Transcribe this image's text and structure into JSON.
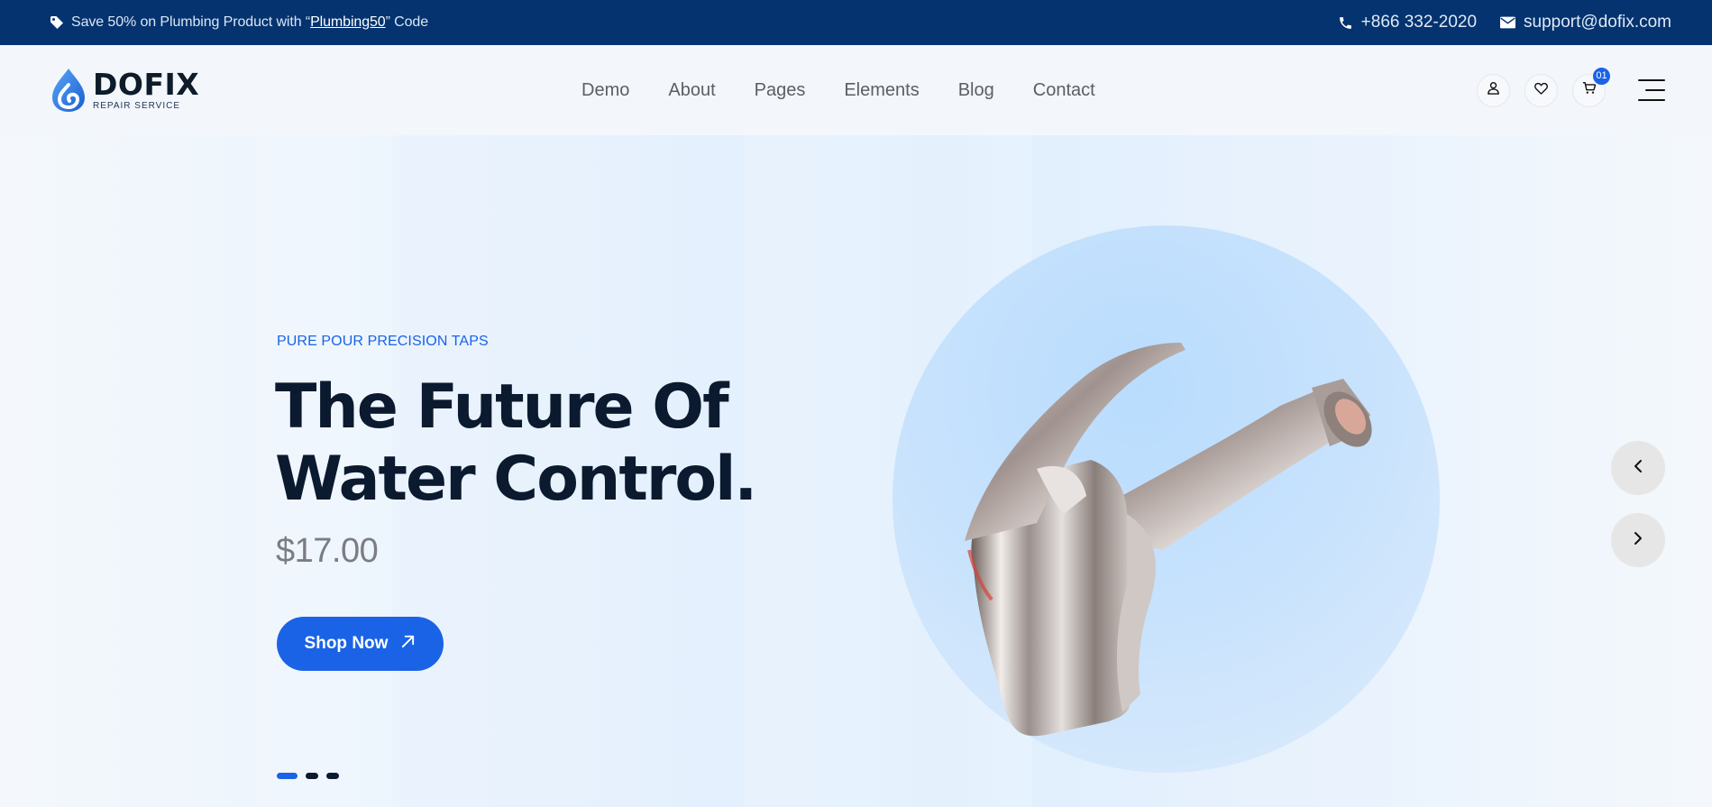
{
  "topbar": {
    "promo_prefix": "Save 50% on Plumbing Product with “",
    "promo_code": "Plumbing50",
    "promo_suffix": "” Code",
    "phone": "+866 332-2020",
    "email": "support@dofix.com",
    "icons": [
      "tag-icon",
      "phone-icon",
      "envelope-icon"
    ]
  },
  "brand": {
    "name": "DOFIX",
    "tagline": "REPAIR SERVICE"
  },
  "nav": {
    "items": [
      "Demo",
      "About",
      "Pages",
      "Elements",
      "Blog",
      "Contact"
    ]
  },
  "header_actions": {
    "cart_count": "01",
    "icons": [
      "user-icon",
      "heart-icon",
      "cart-icon",
      "hamburger-menu-icon"
    ]
  },
  "hero": {
    "eyebrow": "PURE POUR PRECISION TAPS",
    "headline_line1": "The Future Of",
    "headline_line2": "Water Control.",
    "price": "$17.00",
    "cta_label": "Shop Now",
    "slides": 3,
    "active_slide": 1
  },
  "colors": {
    "topbar_bg": "#04336f",
    "accent": "#1a63e6",
    "heading": "#0b1a2e"
  }
}
